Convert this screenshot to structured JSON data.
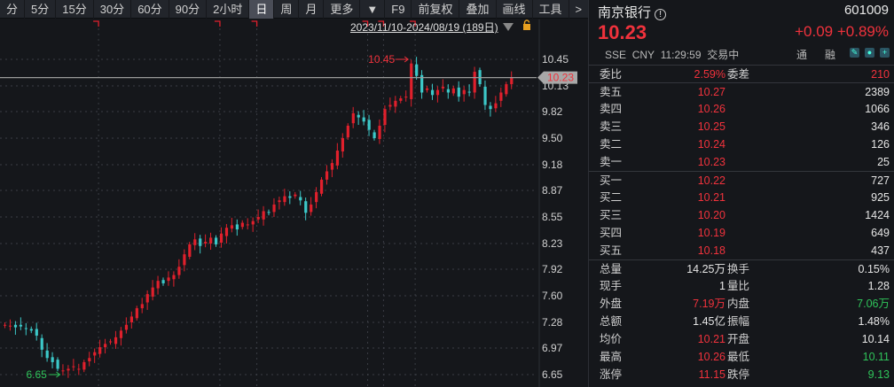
{
  "toolbar": {
    "items": [
      "分",
      "5分",
      "15分",
      "30分",
      "60分",
      "90分",
      "2小时",
      "日",
      "周",
      "月",
      "更多",
      "▼",
      "F9",
      "前复权",
      "叠加",
      "画线",
      "工具",
      ">"
    ],
    "active": "日"
  },
  "chart_header": {
    "range": "2023/11/10-2024/08/19 (189日)"
  },
  "colors": {
    "up": "#e0202c",
    "down": "#3cc8c8",
    "accent": "#f0323c",
    "green": "#2fc45a"
  },
  "chart_data": {
    "type": "candlestick",
    "y_ticks": [
      "10.45",
      "10.13",
      "9.82",
      "9.50",
      "9.18",
      "8.87",
      "8.55",
      "8.23",
      "7.92",
      "7.60",
      "7.28",
      "6.97",
      "6.65"
    ],
    "ylim": [
      6.65,
      10.45
    ],
    "closes": [
      7.25,
      7.24,
      7.22,
      7.23,
      7.2,
      7.18,
      7.12,
      6.95,
      6.85,
      6.8,
      6.72,
      6.7,
      6.72,
      6.75,
      6.72,
      6.8,
      6.85,
      6.92,
      6.98,
      7.02,
      7.05,
      7.1,
      7.18,
      7.25,
      7.35,
      7.45,
      7.5,
      7.62,
      7.7,
      7.78,
      7.75,
      7.82,
      7.85,
      7.95,
      8.1,
      8.22,
      8.28,
      8.2,
      8.25,
      8.3,
      8.22,
      8.35,
      8.42,
      8.45,
      8.4,
      8.48,
      8.46,
      8.5,
      8.55,
      8.62,
      8.6,
      8.7,
      8.75,
      8.8,
      8.78,
      8.82,
      8.75,
      8.6,
      8.7,
      8.85,
      9.0,
      9.1,
      9.2,
      9.35,
      9.5,
      9.65,
      9.8,
      9.75,
      9.7,
      9.6,
      9.5,
      9.65,
      9.85,
      9.9,
      9.95,
      9.98,
      10.0,
      10.4,
      10.25,
      10.05,
      10.1,
      10.02,
      10.08,
      10.12,
      10.05,
      10.1,
      10.0,
      10.08,
      10.05,
      10.3,
      10.15,
      9.9,
      9.85,
      9.92,
      10.05,
      10.15,
      10.23
    ],
    "high_label": "10.45",
    "low_label": "6.65",
    "current_price": "10.23",
    "marker_candles": [
      18,
      41,
      48,
      69,
      72,
      78
    ]
  },
  "quote": {
    "name": "南京银行",
    "code": "601009",
    "price": "10.23",
    "change": "+0.09",
    "change_pct": "+0.89%",
    "exchange": "SSE",
    "currency": "CNY",
    "time": "11:29:59",
    "status": "交易中",
    "tong": "通",
    "rong": "融"
  },
  "order_ratio": {
    "label": "委比",
    "value": "2.59%",
    "label2": "委差",
    "value2": "210"
  },
  "asks": [
    {
      "label": "卖五",
      "price": "10.27",
      "vol": "2389"
    },
    {
      "label": "卖四",
      "price": "10.26",
      "vol": "1066"
    },
    {
      "label": "卖三",
      "price": "10.25",
      "vol": "346"
    },
    {
      "label": "卖二",
      "price": "10.24",
      "vol": "126"
    },
    {
      "label": "卖一",
      "price": "10.23",
      "vol": "25"
    }
  ],
  "bids": [
    {
      "label": "买一",
      "price": "10.22",
      "vol": "727"
    },
    {
      "label": "买二",
      "price": "10.21",
      "vol": "925"
    },
    {
      "label": "买三",
      "price": "10.20",
      "vol": "1424"
    },
    {
      "label": "买四",
      "price": "10.19",
      "vol": "649"
    },
    {
      "label": "买五",
      "price": "10.18",
      "vol": "437"
    }
  ],
  "stats": [
    {
      "l": "总量",
      "v": "14.25万",
      "c1": "white",
      "l2": "换手",
      "v2": "0.15%",
      "c2": "white"
    },
    {
      "l": "现手",
      "v": "1",
      "c1": "white",
      "l2": "量比",
      "v2": "1.28",
      "c2": "white"
    },
    {
      "l": "外盘",
      "v": "7.19万",
      "c1": "red",
      "l2": "内盘",
      "v2": "7.06万",
      "c2": "green"
    },
    {
      "l": "总额",
      "v": "1.45亿",
      "c1": "white",
      "l2": "振幅",
      "v2": "1.48%",
      "c2": "white"
    },
    {
      "l": "均价",
      "v": "10.21",
      "c1": "red",
      "l2": "开盘",
      "v2": "10.14",
      "c2": "white"
    },
    {
      "l": "最高",
      "v": "10.26",
      "c1": "red",
      "l2": "最低",
      "v2": "10.11",
      "c2": "green"
    },
    {
      "l": "涨停",
      "v": "11.15",
      "c1": "red",
      "l2": "跌停",
      "v2": "9.13",
      "c2": "green"
    }
  ]
}
